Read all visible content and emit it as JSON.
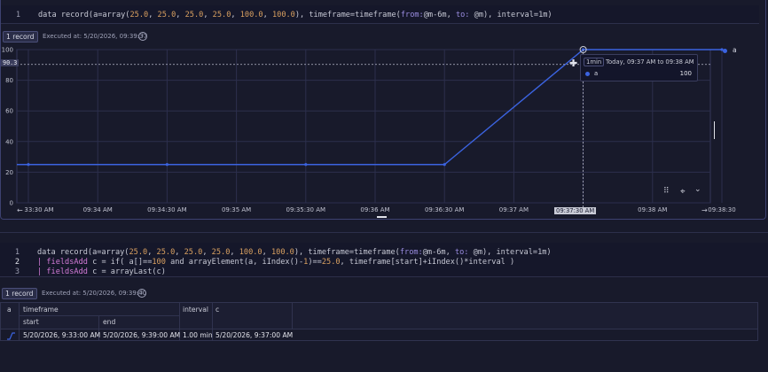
{
  "cell1": {
    "line_number": "1",
    "query_line": {
      "prefix": "data record(a=array(",
      "n1": "25.0",
      "n2": "25.0",
      "n3": "25.0",
      "n4": "25.0",
      "n5": "100.0",
      "n6": "100.0",
      "mid": "), timeframe=timeframe(",
      "from_kw": "from:",
      "from_val": "@m-6m, ",
      "to_kw": "to:",
      "to_val": " @m), interval=1m)"
    },
    "record_badge": "1 record",
    "executed": "Executed at: 5/20/2026, 09:39:37",
    "info_icon": "i",
    "hover_y_label": "90.3",
    "legend": "a",
    "tooltip": {
      "interval": "1min",
      "range": "Today, 09:37 AM to 09:38 AM",
      "series": "a",
      "value": "100"
    },
    "hover_x_label": "09:37:30 AM",
    "toolbar": {
      "drag_icon": "⠿",
      "zoom_icon": "⌖",
      "chevron": "⌄"
    }
  },
  "chart_data": {
    "type": "line",
    "x": [
      "09:33 AM",
      "09:34 AM",
      "09:35 AM",
      "09:36 AM",
      "09:37 AM",
      "09:38 AM"
    ],
    "series": [
      {
        "name": "a",
        "values": [
          25,
          25,
          25,
          25,
          100,
          100
        ]
      }
    ],
    "y_ticks": [
      "0",
      "20",
      "40",
      "60",
      "80",
      "100"
    ],
    "x_ticks": [
      "33:30 AM",
      "09:34 AM",
      "09:34:30 AM",
      "09:35 AM",
      "09:35:30 AM",
      "09:36 AM",
      "09:36:30 AM",
      "09:37 AM",
      "09:37:30 AM",
      "09:38 AM",
      "09:38:30"
    ],
    "ylim": [
      0,
      100
    ],
    "grid": true,
    "legend": "top-right",
    "color": "#3b63e0"
  },
  "cell2": {
    "line_numbers": [
      "1",
      "2",
      "3"
    ],
    "line1": {
      "prefix": "data record(a=array(",
      "n1": "25.0",
      "n2": "25.0",
      "n3": "25.0",
      "n4": "25.0",
      "n5": "100.0",
      "n6": "100.0",
      "mid": "), timeframe=timeframe(",
      "from_kw": "from:",
      "from_val": "@m-6m, ",
      "to_kw": "to:",
      "to_val": " @m), interval=1m)"
    },
    "line2": {
      "pipe": "| ",
      "cmd": "fieldsAdd",
      "rest_a": " c = if( a[]==",
      "n100": "100",
      "rest_b": " and arrayElement(a, iIndex()-",
      "n1": "1",
      "rest_c": ")==",
      "n25": "25.0",
      "rest_d": ", timeframe[start]+iIndex()*interval )"
    },
    "line3": {
      "pipe": "| ",
      "cmd": "fieldsAdd",
      "rest": " c = arrayLast(c)"
    },
    "record_badge": "1 record",
    "executed": "Executed at: 5/20/2026, 09:39:40",
    "info_icon": "i",
    "table": {
      "headers": {
        "a": "a",
        "timeframe": "timeframe",
        "start": "start",
        "end": "end",
        "interval": "interval",
        "c": "c"
      },
      "row": {
        "a_icon": "sparkline-icon",
        "start": "5/20/2026, 9:33:00 AM",
        "end": "5/20/2026, 9:39:00 AM",
        "interval": "1.00 min",
        "c": "5/20/2026, 9:37:00 AM"
      }
    }
  }
}
